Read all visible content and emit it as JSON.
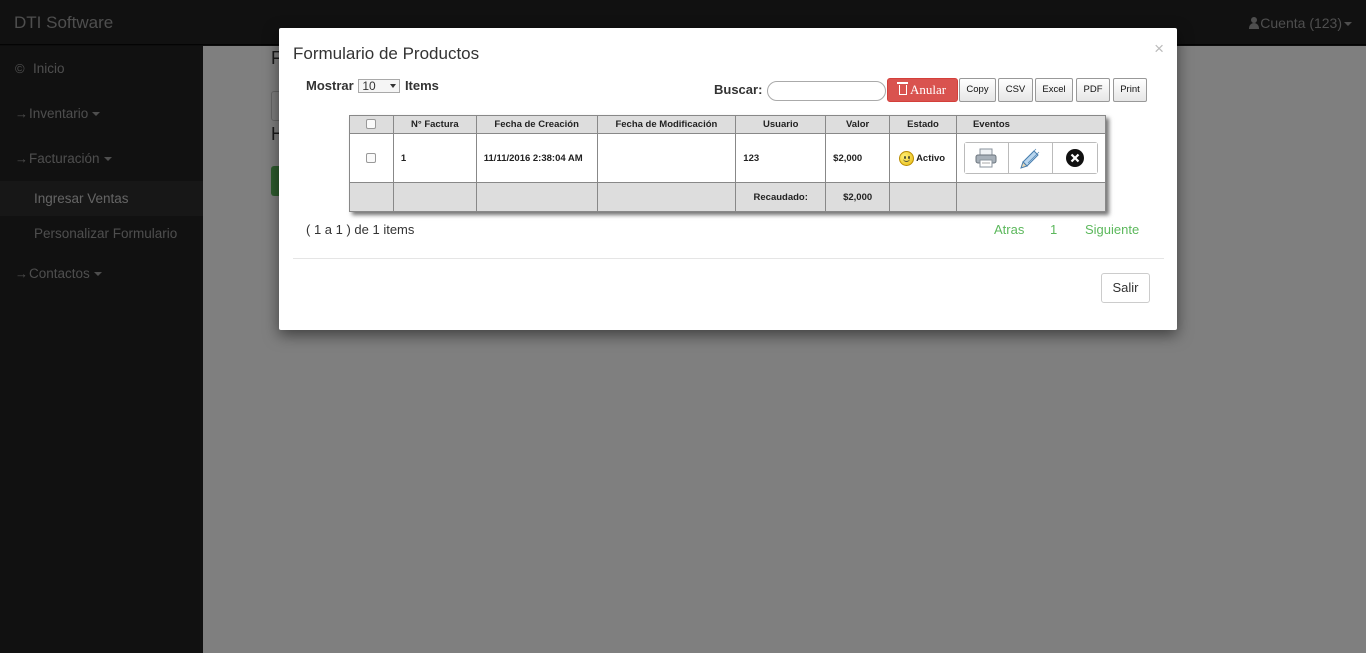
{
  "app": {
    "brand": "DTI Software",
    "account": "Cuenta (123)"
  },
  "sidebar": {
    "inicio": "Inicio",
    "inventario": "Inventario",
    "facturacion": "Facturación",
    "sub_items": [
      "Ingresar Ventas",
      "Personalizar Formulario"
    ],
    "contactos": "Contactos",
    "inicio_icon": "©",
    "arrow_icon": "→"
  },
  "background": {
    "title_letter": "F",
    "heading_letter": "H"
  },
  "modal": {
    "title": "Formulario de Productos",
    "close": "×",
    "show_label": "Mostrar",
    "show_value": "10",
    "items_label": "Items",
    "search_label": "Buscar:",
    "search_value": "",
    "anular_label": "Anular",
    "tools": [
      "Copy",
      "CSV",
      "Excel",
      "PDF",
      "Print"
    ],
    "table": {
      "columns": [
        "",
        "N° Factura",
        "Fecha de Creación",
        "Fecha de Modificación",
        "Usuario",
        "Valor",
        "Estado",
        "Eventos"
      ],
      "rows": [
        {
          "factura": "1",
          "creacion": "11/11/2016 2:38:04 AM",
          "modificacion": "",
          "usuario": "123",
          "valor": "$2,000",
          "estado": "Activo"
        }
      ],
      "footer_label": "Recaudado:",
      "footer_total": "$2,000"
    },
    "pagination": {
      "info": "( 1 a 1 ) de 1 items",
      "prev": "Atras",
      "page": "1",
      "next": "Siguiente"
    },
    "exit_label": "Salir"
  },
  "colors": {
    "danger": "#d9534f",
    "success": "#5cb85c",
    "nav_bg": "#222222"
  }
}
